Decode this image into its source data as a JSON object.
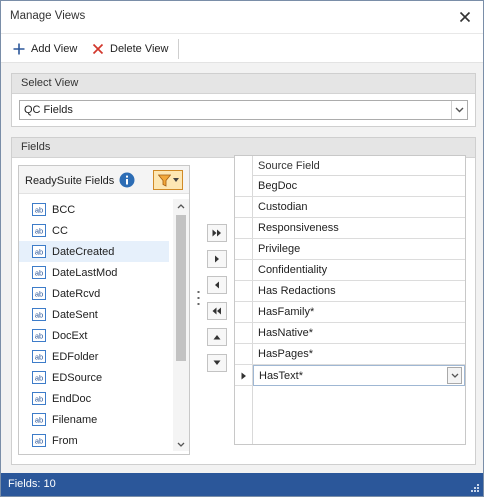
{
  "window": {
    "title": "Manage Views"
  },
  "toolbar": {
    "add_label": "Add View",
    "delete_label": "Delete View"
  },
  "select_view": {
    "group_label": "Select View",
    "selected": "QC Fields"
  },
  "fields": {
    "group_label": "Fields",
    "list_title": "ReadySuite Fields",
    "available": [
      "BCC",
      "CC",
      "DateCreated",
      "DateLastMod",
      "DateRcvd",
      "DateSent",
      "DocExt",
      "EDFolder",
      "EDSource",
      "EndDoc",
      "Filename",
      "From"
    ],
    "selected_available": "DateCreated",
    "grid_header": "Source Field",
    "source_fields": [
      "BegDoc",
      "Custodian",
      "Responsiveness",
      "Privilege",
      "Confidentiality",
      "Has Redactions",
      "HasFamily*",
      "HasNative*",
      "HasPages*",
      "HasText*"
    ],
    "active_row": "HasText*"
  },
  "status": {
    "text": "Fields: 10"
  },
  "colors": {
    "statusbar": "#2b579a",
    "add_icon": "#2b579a",
    "delete_icon": "#d2372c",
    "filter_btn": "#fde7b3",
    "list_selection": "#e6f0fb"
  },
  "icons": {
    "close": "close-icon",
    "add": "plus-icon",
    "delete": "x-icon",
    "info": "info-icon",
    "filter": "funnel-icon",
    "field_type": "ab-text-field-icon",
    "move_all_right": "double-chevron-right-icon",
    "move_right": "chevron-right-icon",
    "move_left": "chevron-left-icon",
    "move_all_left": "double-chevron-left-icon",
    "move_up": "triangle-up-icon",
    "move_down": "triangle-down-icon"
  }
}
